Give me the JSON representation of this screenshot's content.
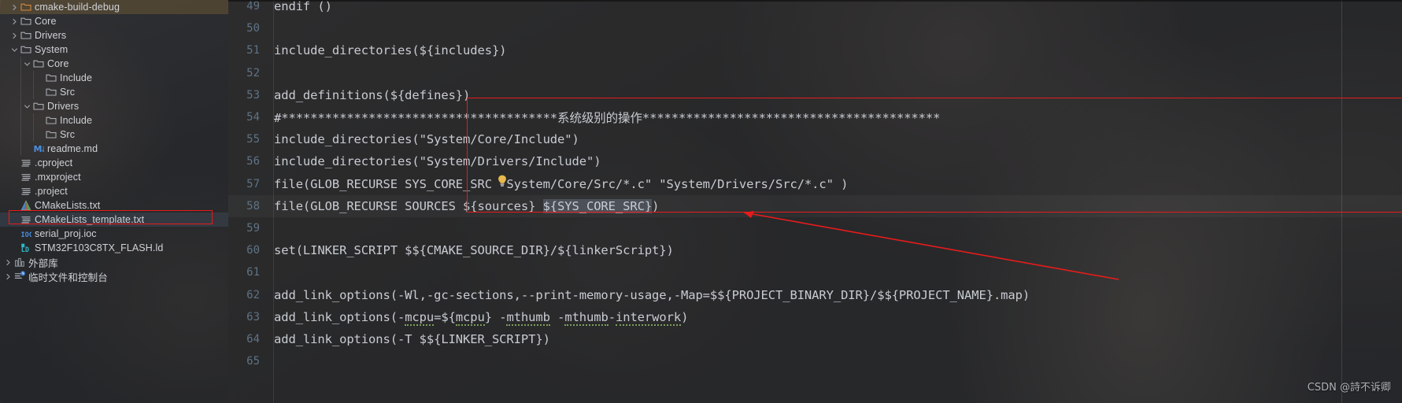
{
  "window": {
    "watermark": "CSDN @詩不诉卿"
  },
  "sidebar": {
    "name": "project-tree",
    "items": [
      {
        "label": "cmake-build-debug",
        "indent": 0,
        "arrow": "right",
        "icon": "folder-orange-icon",
        "state": "highlight"
      },
      {
        "label": "Core",
        "indent": 0,
        "arrow": "right",
        "icon": "folder-icon",
        "state": "normal"
      },
      {
        "label": "Drivers",
        "indent": 0,
        "arrow": "right",
        "icon": "folder-icon",
        "state": "normal"
      },
      {
        "label": "System",
        "indent": 0,
        "arrow": "down",
        "icon": "folder-icon",
        "state": "normal"
      },
      {
        "label": "Core",
        "indent": 1,
        "arrow": "down",
        "icon": "folder-icon",
        "state": "normal"
      },
      {
        "label": "Include",
        "indent": 2,
        "arrow": "none",
        "icon": "folder-icon",
        "state": "normal"
      },
      {
        "label": "Src",
        "indent": 2,
        "arrow": "none",
        "icon": "folder-icon",
        "state": "normal"
      },
      {
        "label": "Drivers",
        "indent": 1,
        "arrow": "down",
        "icon": "folder-icon",
        "state": "normal"
      },
      {
        "label": "Include",
        "indent": 2,
        "arrow": "none",
        "icon": "folder-icon",
        "state": "normal"
      },
      {
        "label": "Src",
        "indent": 2,
        "arrow": "none",
        "icon": "folder-icon",
        "state": "normal"
      },
      {
        "label": "readme.md",
        "indent": 1,
        "arrow": "none",
        "icon": "markdown-icon",
        "state": "normal"
      },
      {
        "label": ".cproject",
        "indent": 0,
        "arrow": "none",
        "icon": "text-file-icon",
        "state": "normal"
      },
      {
        "label": ".mxproject",
        "indent": 0,
        "arrow": "none",
        "icon": "text-file-icon",
        "state": "normal"
      },
      {
        "label": ".project",
        "indent": 0,
        "arrow": "none",
        "icon": "text-file-icon",
        "state": "normal"
      },
      {
        "label": "CMakeLists.txt",
        "indent": 0,
        "arrow": "none",
        "icon": "cmake-icon",
        "state": "normal"
      },
      {
        "label": "CMakeLists_template.txt",
        "indent": 0,
        "arrow": "none",
        "icon": "text-file-icon",
        "state": "selected"
      },
      {
        "label": "serial_proj.ioc",
        "indent": 0,
        "arrow": "none",
        "icon": "ioc-icon",
        "state": "normal"
      },
      {
        "label": "STM32F103C8TX_FLASH.ld",
        "indent": 0,
        "arrow": "none",
        "icon": "ld-icon",
        "state": "normal"
      },
      {
        "label": "外部库",
        "indent": -1,
        "arrow": "right",
        "icon": "library-icon",
        "state": "normal"
      },
      {
        "label": "临时文件和控制台",
        "indent": -1,
        "arrow": "right",
        "icon": "scratches-icon",
        "state": "normal"
      }
    ]
  },
  "editor": {
    "name": "cmake-editor",
    "lines": [
      {
        "num": "49",
        "text": "endif ()"
      },
      {
        "num": "50",
        "text": ""
      },
      {
        "num": "51",
        "text": "include_directories(${includes})"
      },
      {
        "num": "52",
        "text": ""
      },
      {
        "num": "53",
        "text": "add_definitions(${defines})"
      },
      {
        "num": "54",
        "text": "#**************************************系统级别的操作*****************************************"
      },
      {
        "num": "55",
        "text": "include_directories(\"System/Core/Include\")"
      },
      {
        "num": "56",
        "text": "include_directories(\"System/Drivers/Include\")"
      },
      {
        "num": "57",
        "text": "file(GLOB_RECURSE SYS_CORE_SRC \"System/Core/Src/*.c\" \"System/Drivers/Src/*.c\" )"
      },
      {
        "num": "58",
        "text": "file(GLOB_RECURSE SOURCES ${sources} ${SYS_CORE_SRC})"
      },
      {
        "num": "59",
        "text": ""
      },
      {
        "num": "60",
        "text": "set(LINKER_SCRIPT $${CMAKE_SOURCE_DIR}/${linkerScript})"
      },
      {
        "num": "61",
        "text": ""
      },
      {
        "num": "62",
        "text": "add_link_options(-Wl,-gc-sections,--print-memory-usage,-Map=$${PROJECT_BINARY_DIR}/$${PROJECT_NAME}.map)"
      },
      {
        "num": "63",
        "text": "add_link_options(-mcpu=${mcpu} -mthumb -mthumb-interwork)"
      },
      {
        "num": "64",
        "text": "add_link_options(-T $${LINKER_SCRIPT})"
      },
      {
        "num": "65",
        "text": ""
      }
    ],
    "selection": {
      "line": "58",
      "prefix": "file(GLOB_RECURSE SOURCES ${sources} ",
      "selected": "${SYS_CORE_SRC}",
      "suffix": ")"
    },
    "line_54_parts": {
      "stars_left": "#**************************************",
      "chinese": "系统级别的操作",
      "stars_right": "*****************************************"
    },
    "line_63_parts": {
      "before": "add_link_options(-",
      "w1": "mcpu",
      "mid1": "=${",
      "w2": "mcpu",
      "mid2": "} -",
      "w3": "mthumb",
      "mid3": " -",
      "w4": "mthumb",
      "mid4": "-",
      "w5": "interwork",
      "after": ")"
    },
    "annotations": {
      "redbox_label": "red-highlight-box",
      "arrow_label": "red-pointer-arrow",
      "bulb_label": "intention-bulb"
    }
  },
  "colors": {
    "accent_red": "#e81b1b",
    "line_number": "#5f7385",
    "code_text": "#c8ccd2",
    "sidebar_text": "#cfd2d6",
    "folder_orange": "#d6893a",
    "selection_blue": "#8796ac"
  }
}
